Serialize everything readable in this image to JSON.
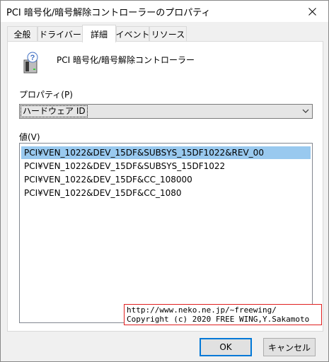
{
  "window": {
    "title": "PCI 暗号化/暗号解除コントローラーのプロパティ"
  },
  "tabs": [
    {
      "label": "全般"
    },
    {
      "label": "ドライバー"
    },
    {
      "label": "詳細"
    },
    {
      "label": "イベント"
    },
    {
      "label": "リソース"
    }
  ],
  "active_tab": "詳細",
  "device": {
    "name": "PCI 暗号化/暗号解除コントローラー",
    "icon": "unknown-device-icon"
  },
  "property": {
    "label": "プロパティ(P)",
    "selected": "ハードウェア ID"
  },
  "values": {
    "label": "値(V)",
    "items": [
      "PCI¥VEN_1022&DEV_15DF&SUBSYS_15DF1022&REV_00",
      "PCI¥VEN_1022&DEV_15DF&SUBSYS_15DF1022",
      "PCI¥VEN_1022&DEV_15DF&CC_108000",
      "PCI¥VEN_1022&DEV_15DF&CC_1080"
    ],
    "selected_index": 0
  },
  "watermark": {
    "line1": "http://www.neko.ne.jp/~freewing/",
    "line2": "Copyright (c) 2020 FREE WING,Y.Sakamoto"
  },
  "buttons": {
    "ok": "OK",
    "cancel": "キャンセル"
  },
  "colors": {
    "selection": "#99c9ef",
    "watermark_border": "#e02020",
    "default_button_border": "#0078d7"
  }
}
